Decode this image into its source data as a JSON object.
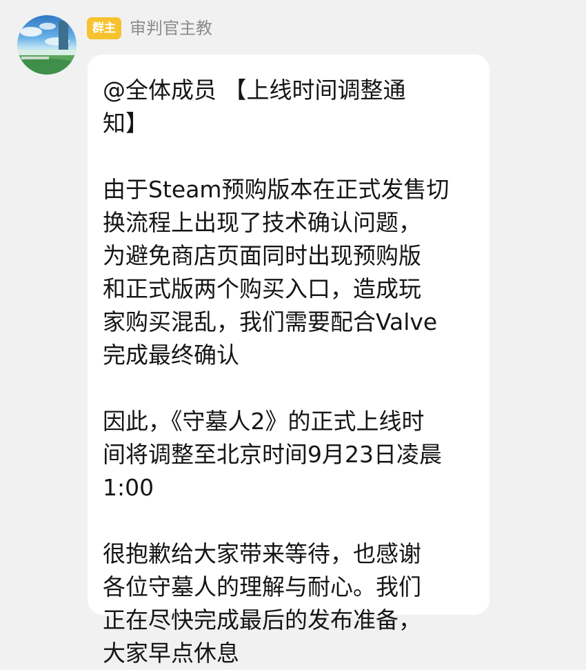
{
  "avatar": {
    "icon": "anime-landscape-avatar"
  },
  "sender": {
    "role_badge": "群主",
    "name": "审判官主教",
    "badge_color": "#f6c22f"
  },
  "message": {
    "lines": [
      "@全体成员 【上线时间调整通",
      "知】",
      "",
      "由于Steam预购版本在正式发售切",
      "换流程上出现了技术确认问题，",
      "为避免商店页面同时出现预购版",
      "和正式版两个购买入口，造成玩",
      "家购买混乱，我们需要配合Valve",
      "完成最终确认",
      "",
      "因此，《守墓人2》的正式上线时",
      "间将调整至北京时间9月23日凌晨",
      "1:00",
      "",
      "很抱歉给大家带来等待，也感谢",
      "各位守墓人的理解与耐心。我们",
      "正在尽快完成最后的发布准备，",
      "大家早点休息"
    ]
  }
}
